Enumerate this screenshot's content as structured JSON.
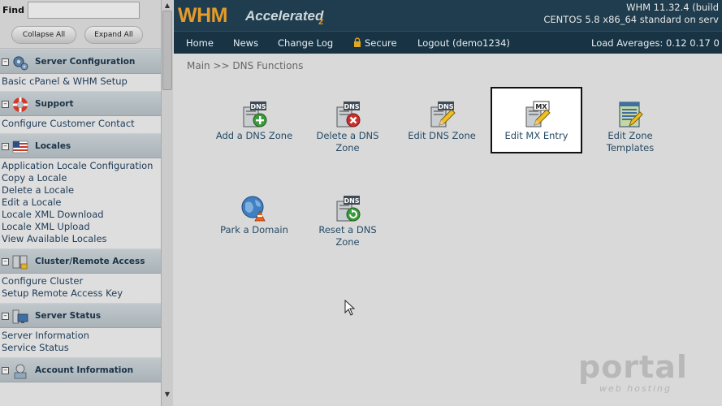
{
  "left_frame": {
    "find_label": "Find",
    "collapse_all": "Collapse All",
    "expand_all": "Expand All",
    "sections": [
      {
        "title": "Server Configuration",
        "icon": "gears-icon",
        "items": [
          "Basic cPanel & WHM Setup"
        ]
      },
      {
        "title": "Support",
        "icon": "lifebuoy-icon",
        "items": [
          "Configure Customer Contact"
        ]
      },
      {
        "title": "Locales",
        "icon": "flag-icon",
        "items": [
          "Application Locale Configuration",
          "Copy a Locale",
          "Delete a Locale",
          "Edit a Locale",
          "Locale XML Download",
          "Locale XML Upload",
          "View Available Locales"
        ]
      },
      {
        "title": "Cluster/Remote Access",
        "icon": "servers-lock-icon",
        "items": [
          "Configure Cluster",
          "Setup Remote Access Key"
        ]
      },
      {
        "title": "Server Status",
        "icon": "monitor-icon",
        "items": [
          "Server Information",
          "Service Status"
        ]
      },
      {
        "title": "Account Information",
        "icon": "account-icon",
        "items": []
      }
    ]
  },
  "header": {
    "logo_main": "WHM",
    "logo_sub": "Accelerated",
    "logo_sub2": "2",
    "version_line1": "WHM 11.32.4 (build",
    "version_line2": "CENTOS 5.8 x86_64 standard on serv"
  },
  "nav": {
    "home": "Home",
    "news": "News",
    "changelog": "Change Log",
    "secure": "Secure",
    "logout": "Logout (demo1234)",
    "load": "Load Averages: 0.12 0.17 0"
  },
  "breadcrumb": "Main >> DNS Functions",
  "tiles": [
    {
      "line1": "Add a DNS Zone",
      "line2": "",
      "icon": "dns-add-icon"
    },
    {
      "line1": "Delete a DNS",
      "line2": "Zone",
      "icon": "dns-delete-icon"
    },
    {
      "line1": "Edit DNS Zone",
      "line2": "",
      "icon": "dns-edit-icon"
    },
    {
      "line1": "Edit MX Entry",
      "line2": "",
      "icon": "mx-edit-icon"
    },
    {
      "line1": "Edit Zone",
      "line2": "Templates",
      "icon": "zone-templates-icon"
    },
    {
      "line1": "Park a Domain",
      "line2": "",
      "icon": "park-domain-icon"
    },
    {
      "line1": "Reset a DNS",
      "line2": "Zone",
      "icon": "dns-reset-icon"
    }
  ],
  "watermark": {
    "main": "portal",
    "sub": "web hosting"
  }
}
